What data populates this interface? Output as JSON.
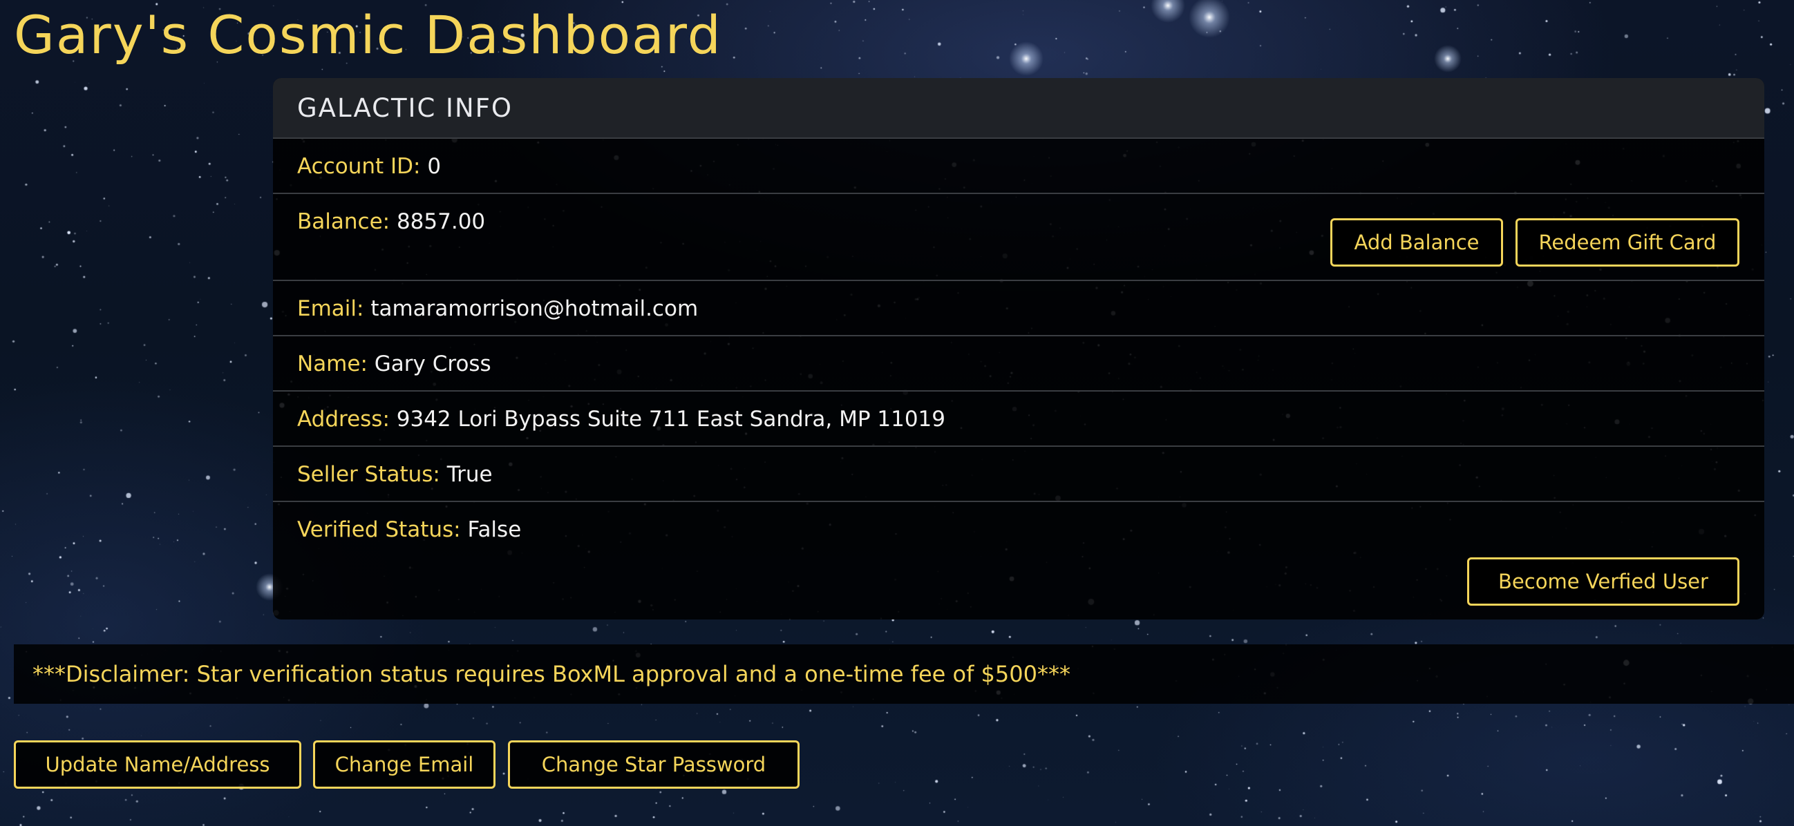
{
  "page": {
    "title": "Gary's Cosmic Dashboard"
  },
  "card": {
    "header": "GALACTIC INFO",
    "account_id": {
      "label": "Account ID:",
      "value": "0"
    },
    "balance": {
      "label": "Balance:",
      "value": "8857.00"
    },
    "email": {
      "label": "Email:",
      "value": "tamaramorrison@hotmail.com"
    },
    "name": {
      "label": "Name:",
      "value": "Gary Cross"
    },
    "address": {
      "label": "Address:",
      "value": "9342 Lori Bypass Suite 711 East Sandra, MP 11019"
    },
    "seller_status": {
      "label": "Seller Status:",
      "value": "True"
    },
    "verified_status": {
      "label": "Verified Status:",
      "value": "False"
    },
    "buttons": {
      "add_balance": "Add Balance",
      "redeem_gift_card": "Redeem Gift Card",
      "become_verified": "Become Verfied User"
    }
  },
  "disclaimer": "***Disclaimer: Star verification status requires BoxML approval and a one-time fee of $500***",
  "actions": {
    "update_name_address": "Update Name/Address",
    "change_email": "Change Email",
    "change_star_password": "Change Star Password"
  },
  "colors": {
    "accent": "#f5d55a",
    "card_bg": "#000000",
    "header_bg": "#1f2227",
    "text": "#f2f2f2"
  }
}
